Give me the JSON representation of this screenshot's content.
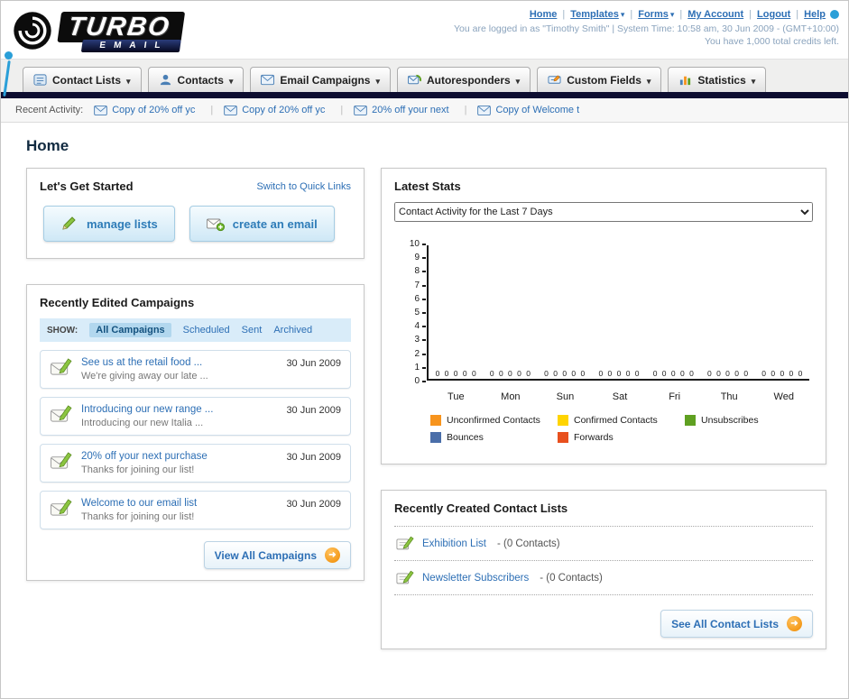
{
  "header": {
    "logo": {
      "title": "TURBO",
      "subtitle": "EMAIL"
    },
    "nav_items": [
      {
        "label": "Home"
      },
      {
        "label": "Templates"
      },
      {
        "label": "Forms"
      },
      {
        "label": "My Account"
      },
      {
        "label": "Logout"
      },
      {
        "label": "Help"
      }
    ],
    "session_line": "You are logged in as \"Timothy Smith\" | System Time: 10:58 am, 30 Jun 2009 - (GMT+10:00)",
    "credits_line": "You have 1,000 total credits left."
  },
  "main_tabs": [
    {
      "label": "Contact Lists"
    },
    {
      "label": "Contacts"
    },
    {
      "label": "Email Campaigns"
    },
    {
      "label": "Autoresponders"
    },
    {
      "label": "Custom Fields"
    },
    {
      "label": "Statistics"
    }
  ],
  "recent_activity": {
    "label": "Recent Activity:",
    "items": [
      {
        "label": "Copy of 20% off yc"
      },
      {
        "label": "Copy of 20% off yc"
      },
      {
        "label": "20% off your next"
      },
      {
        "label": "Copy of Welcome t"
      }
    ]
  },
  "page_title": "Home",
  "get_started": {
    "title": "Let's Get Started",
    "switch_link": "Switch to Quick Links",
    "manage_lists_button": "manage lists",
    "create_email_button": "create an email"
  },
  "campaigns": {
    "title": "Recently Edited Campaigns",
    "show_label": "SHOW:",
    "filters": [
      {
        "label": "All Campaigns"
      },
      {
        "label": "Scheduled"
      },
      {
        "label": "Sent"
      },
      {
        "label": "Archived"
      }
    ],
    "items": [
      {
        "title": "See us at the retail food ...",
        "subtitle": "We're giving away our late ...",
        "date": "30 Jun 2009"
      },
      {
        "title": "Introducing our new range ...",
        "subtitle": "Introducing our new Italia ...",
        "date": "30 Jun 2009"
      },
      {
        "title": "20% off your next purchase",
        "subtitle": "Thanks for joining our list!",
        "date": "30 Jun 2009"
      },
      {
        "title": "Welcome to our email list",
        "subtitle": "Thanks for joining our list!",
        "date": "30 Jun 2009"
      }
    ],
    "view_all_button": "View All Campaigns"
  },
  "stats": {
    "title": "Latest Stats",
    "selected_filter": "Contact Activity for the Last 7 Days",
    "chart_data": {
      "type": "bar",
      "categories": [
        "Tue",
        "Mon",
        "Sun",
        "Sat",
        "Fri",
        "Thu",
        "Wed"
      ],
      "series": [
        {
          "name": "Unconfirmed Contacts",
          "color": "#f7941d",
          "values": [
            0,
            0,
            0,
            0,
            0,
            0,
            0
          ]
        },
        {
          "name": "Confirmed Contacts",
          "color": "#ffd400",
          "values": [
            0,
            0,
            0,
            0,
            0,
            0,
            0
          ]
        },
        {
          "name": "Unsubscribes",
          "color": "#5fa021",
          "values": [
            0,
            0,
            0,
            0,
            0,
            0,
            0
          ]
        },
        {
          "name": "Bounces",
          "color": "#4a6ea9",
          "values": [
            0,
            0,
            0,
            0,
            0,
            0,
            0
          ]
        },
        {
          "name": "Forwards",
          "color": "#e8501e",
          "values": [
            0,
            0,
            0,
            0,
            0,
            0,
            0
          ]
        }
      ],
      "ylim": [
        0,
        10
      ],
      "yticks": [
        10,
        9,
        8,
        7,
        6,
        5,
        4,
        3,
        2,
        1,
        0
      ],
      "grid": false,
      "legend_position": "bottom"
    }
  },
  "contact_lists": {
    "title": "Recently Created Contact Lists",
    "items": [
      {
        "name": "Exhibition List",
        "detail": "- (0 Contacts)"
      },
      {
        "name": "Newsletter Subscribers",
        "detail": "- (0 Contacts)"
      }
    ],
    "see_all_button": "See All Contact Lists"
  }
}
